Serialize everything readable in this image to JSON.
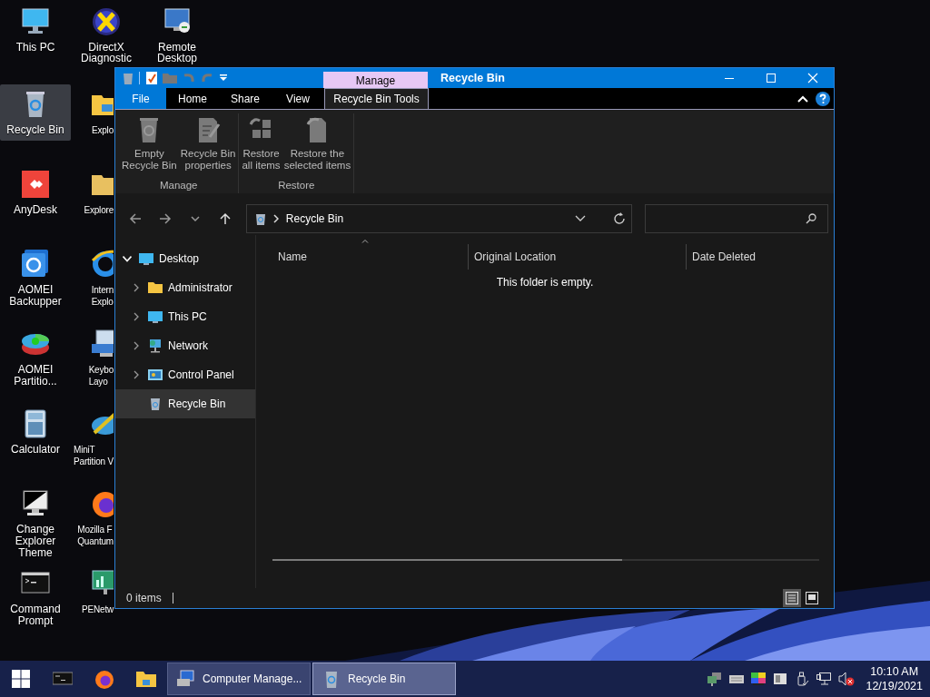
{
  "desktop_icons": [
    {
      "label": "This PC",
      "selected": false
    },
    {
      "label": "Recycle Bin",
      "selected": true
    },
    {
      "label": "AnyDesk",
      "selected": false
    },
    {
      "label": "AOMEI\nBackupper",
      "selected": false
    },
    {
      "label": "AOMEI\nPartitio...",
      "selected": false
    },
    {
      "label": "Calculator",
      "selected": false
    },
    {
      "label": "Change\nExplorer Theme",
      "selected": false
    },
    {
      "label": "Command\nPrompt",
      "selected": false
    },
    {
      "label": "DirectX\nDiagnostic",
      "selected": false
    },
    {
      "label": "Explo",
      "selected": false
    },
    {
      "label": "Explore",
      "selected": false
    },
    {
      "label": "Intern\nExplo",
      "selected": false
    },
    {
      "label": "Keybo\nLayo",
      "selected": false
    },
    {
      "label": "MiniT\nPartition V",
      "selected": false
    },
    {
      "label": "Mozilla F\nQuantum",
      "selected": false
    },
    {
      "label": "PENetw",
      "selected": false
    },
    {
      "label": "Remote\nDesktop",
      "selected": false
    }
  ],
  "window": {
    "title": "Recycle Bin",
    "contextual_group": "Manage",
    "tabs": [
      {
        "label": "File",
        "kind": "file",
        "selected": false
      },
      {
        "label": "Home",
        "kind": "normal",
        "selected": false
      },
      {
        "label": "Share",
        "kind": "normal",
        "selected": false
      },
      {
        "label": "View",
        "kind": "normal",
        "selected": false
      },
      {
        "label": "Recycle Bin Tools",
        "kind": "contextual",
        "selected": true
      }
    ],
    "ribbon_groups": [
      {
        "label": "Manage",
        "buttons": [
          {
            "label": "Empty\nRecycle Bin"
          },
          {
            "label": "Recycle Bin\nproperties"
          }
        ]
      },
      {
        "label": "Restore",
        "buttons": [
          {
            "label": "Restore\nall items"
          },
          {
            "label": "Restore the\nselected items"
          }
        ]
      }
    ],
    "address": "Recycle Bin",
    "nav_tree": [
      {
        "label": "Desktop",
        "expandable": true,
        "expanded": true,
        "selected": false,
        "children": [
          {
            "label": "Administrator",
            "expandable": true,
            "expanded": false,
            "selected": false
          },
          {
            "label": "This PC",
            "expandable": true,
            "expanded": false,
            "selected": false
          },
          {
            "label": "Network",
            "expandable": true,
            "expanded": false,
            "selected": false
          },
          {
            "label": "Control Panel",
            "expandable": true,
            "expanded": false,
            "selected": false
          },
          {
            "label": "Recycle Bin",
            "expandable": false,
            "expanded": false,
            "selected": true
          }
        ]
      }
    ],
    "columns": [
      {
        "label": "Name",
        "sorted": true
      },
      {
        "label": "Original Location",
        "sorted": false
      },
      {
        "label": "Date Deleted",
        "sorted": false
      }
    ],
    "empty_message": "This folder is empty.",
    "status": "0 items",
    "view_buttons": [
      {
        "kind": "details",
        "selected": true
      },
      {
        "kind": "large-icons",
        "selected": false
      }
    ]
  },
  "taskbar": {
    "tasks": [
      {
        "label": "Computer Manage...",
        "selected": false
      },
      {
        "label": "Recycle Bin",
        "selected": true
      }
    ],
    "time": "10:10 AM",
    "date": "12/19/2021"
  }
}
